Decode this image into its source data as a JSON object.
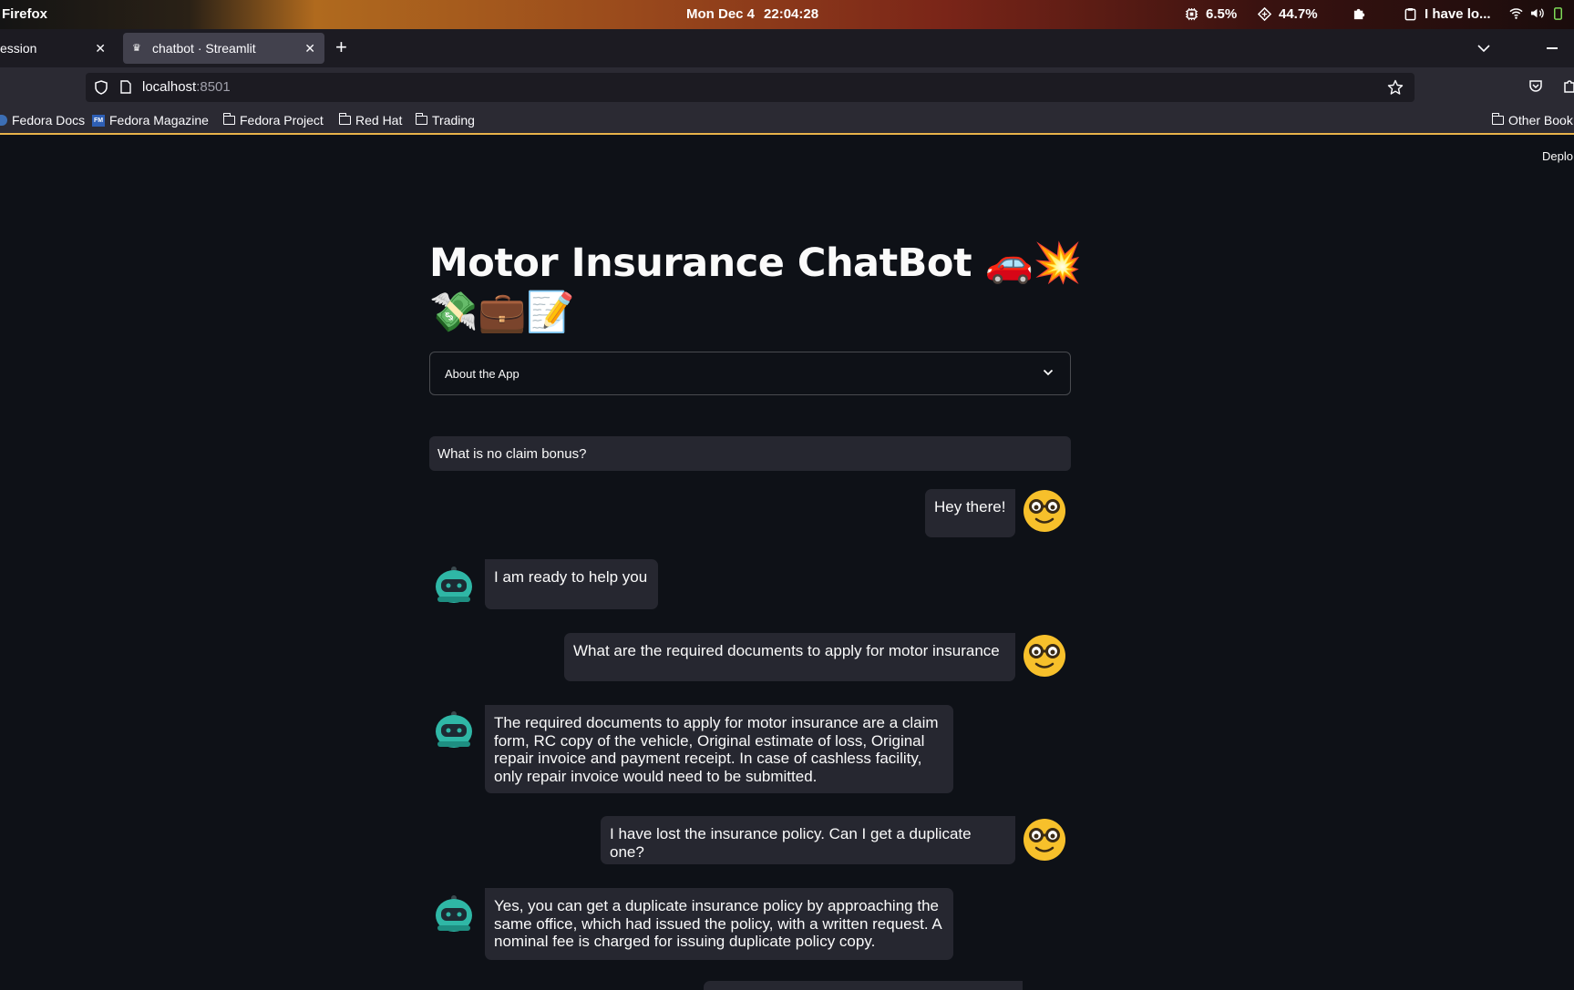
{
  "system_bar": {
    "app_name": "Firefox",
    "date": "Mon Dec 4",
    "time": "22:04:28",
    "cpu": "6.5%",
    "memory": "44.7%",
    "clipboard": "I have lo..."
  },
  "browser": {
    "tabs": [
      {
        "label": "ession"
      },
      {
        "label": "chatbot · Streamlit"
      }
    ],
    "url_host": "localhost",
    "url_port": ":8501",
    "bookmarks": [
      {
        "label": "Fedora Docs"
      },
      {
        "label": "Fedora Magazine"
      },
      {
        "label": "Fedora Project"
      },
      {
        "label": "Red Hat"
      },
      {
        "label": "Trading"
      },
      {
        "label": "Other Book"
      }
    ]
  },
  "app": {
    "deploy_label": "Deplo",
    "title": "Motor Insurance ChatBot 🚗💥💸💼📝",
    "expander_label": "About the App",
    "question": "What is no claim bonus?",
    "messages": [
      {
        "role": "user",
        "text": "Hey there!"
      },
      {
        "role": "bot",
        "text": "I am ready to help you"
      },
      {
        "role": "user",
        "text": "What are the required documents to apply for motor insurance"
      },
      {
        "role": "bot",
        "text": "The required documents to apply for motor insurance are a claim form, RC copy of the vehicle, Original estimate of loss, Original repair invoice and payment receipt. In case of cashless facility, only repair invoice would need to be submitted."
      },
      {
        "role": "user",
        "text": "I have lost the insurance policy. Can I get a duplicate one?"
      },
      {
        "role": "bot",
        "text": "Yes, you can get a duplicate insurance policy by approaching the same office, which had issued the policy, with a written request. A nominal fee is charged for issuing duplicate policy copy."
      }
    ]
  },
  "colors": {
    "page_bg": "#0e1117",
    "bubble_bg": "#262730",
    "user_avatar": "#f7c02b",
    "bot_avatar": "#2fb7a6"
  }
}
